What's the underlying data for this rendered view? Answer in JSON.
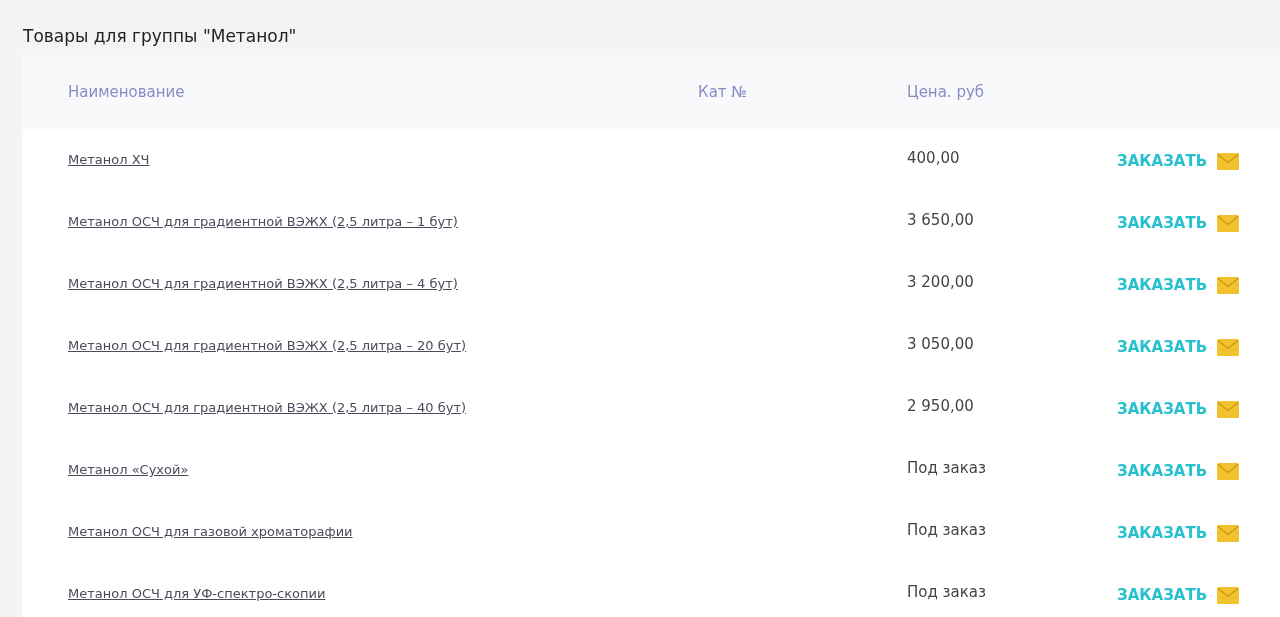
{
  "title": "Товары для группы \"Метанол\"",
  "table": {
    "columns": [
      "Наименование",
      "Кат №",
      "Цена. руб"
    ],
    "rows": [
      {
        "name": "Метанол ХЧ",
        "price": "400,00",
        "action": "ЗАКАЗАТЬ"
      },
      {
        "name": "Метанол ОСЧ для градиентной ВЭЖХ (2,5 литра – 1 бут)",
        "price": "3 650,00",
        "action": "ЗАКАЗАТЬ"
      },
      {
        "name": "Метанол ОСЧ для градиентной ВЭЖХ (2,5 литра – 4 бут)",
        "price": "3 200,00",
        "action": "ЗАКАЗАТЬ"
      },
      {
        "name": "Метанол ОСЧ для градиентной ВЭЖХ (2,5 литра – 20 бут)",
        "price": "3 050,00",
        "action": "ЗАКАЗАТЬ"
      },
      {
        "name": "Метанол ОСЧ для градиентной ВЭЖХ (2,5 литра – 40 бут)",
        "price": "2 950,00",
        "action": "ЗАКАЗАТЬ"
      },
      {
        "name": "Метанол «Сухой»",
        "price": "Под заказ",
        "action": "ЗАКАЗАТЬ"
      },
      {
        "name": "Метанол ОСЧ для газовой хроматорафии",
        "price": "Под заказ",
        "action": "ЗАКАЗАТЬ"
      },
      {
        "name": "Метанол ОСЧ для УФ-спектро-скопии",
        "price": "Под заказ",
        "action": "ЗАКАЗАТЬ"
      }
    ]
  }
}
